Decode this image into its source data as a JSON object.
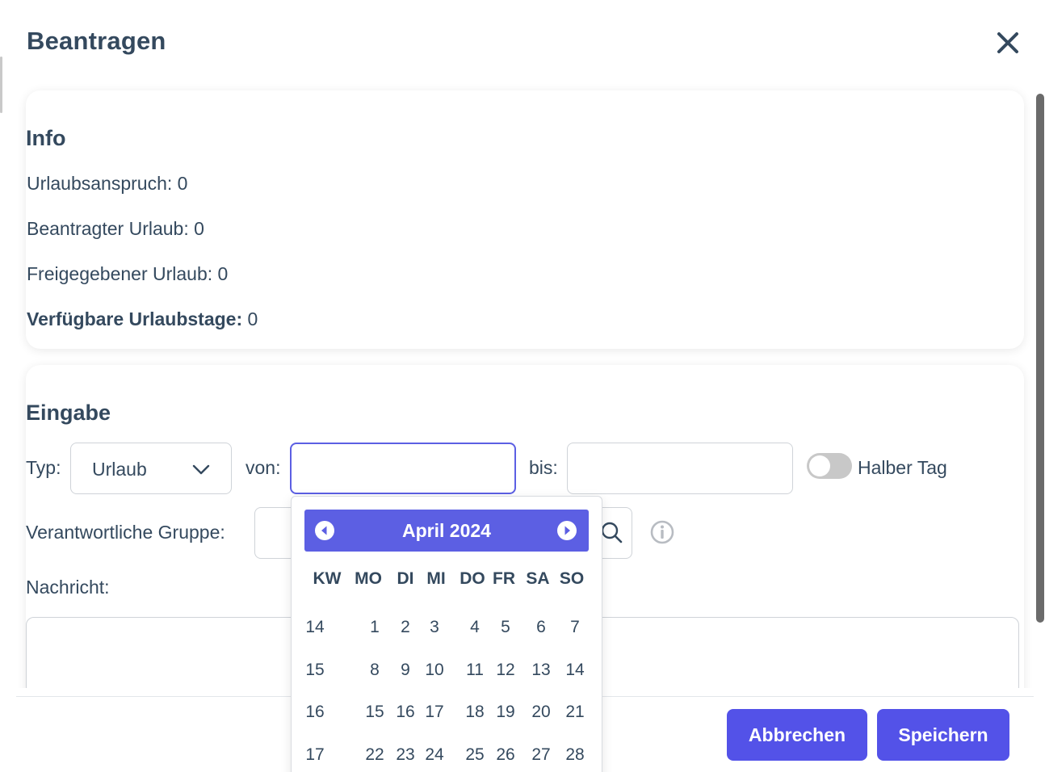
{
  "modal": {
    "title": "Beantragen"
  },
  "info": {
    "title": "Info",
    "urlaubsanspruch": "Urlaubsanspruch: 0",
    "beantragter": "Beantragter Urlaub: 0",
    "freigegebener": "Freigegebener Urlaub: 0",
    "verfuegbar_label": "Verfügbare Urlaubstage:",
    "verfuegbar_value": " 0"
  },
  "eingabe": {
    "title": "Eingabe",
    "typ_label": "Typ:",
    "typ_value": "Urlaub",
    "von_label": "von:",
    "von_value": "",
    "bis_label": "bis:",
    "bis_value": "",
    "halber_tag_label": "Halber Tag",
    "halber_tag_on": false,
    "gruppe_label": "Verantwortliche Gruppe:",
    "gruppe_value": "",
    "nachricht_label": "Nachricht:",
    "nachricht_value": ""
  },
  "datepicker": {
    "title": "April 2024",
    "weekday_headers": [
      "KW",
      "MO",
      "DI",
      "MI",
      "DO",
      "FR",
      "SA",
      "SO"
    ],
    "weeks": [
      {
        "kw": "14",
        "days": [
          "1",
          "2",
          "3",
          "4",
          "5",
          "6",
          "7"
        ]
      },
      {
        "kw": "15",
        "days": [
          "8",
          "9",
          "10",
          "11",
          "12",
          "13",
          "14"
        ]
      },
      {
        "kw": "16",
        "days": [
          "15",
          "16",
          "17",
          "18",
          "19",
          "20",
          "21"
        ]
      },
      {
        "kw": "17",
        "days": [
          "22",
          "23",
          "24",
          "25",
          "26",
          "27",
          "28"
        ]
      }
    ]
  },
  "footer": {
    "cancel_label": "Abbrechen",
    "save_label": "Speichern"
  },
  "colors": {
    "primary": "#5352e8",
    "text": "#34495e",
    "border": "#cfd3d8"
  }
}
